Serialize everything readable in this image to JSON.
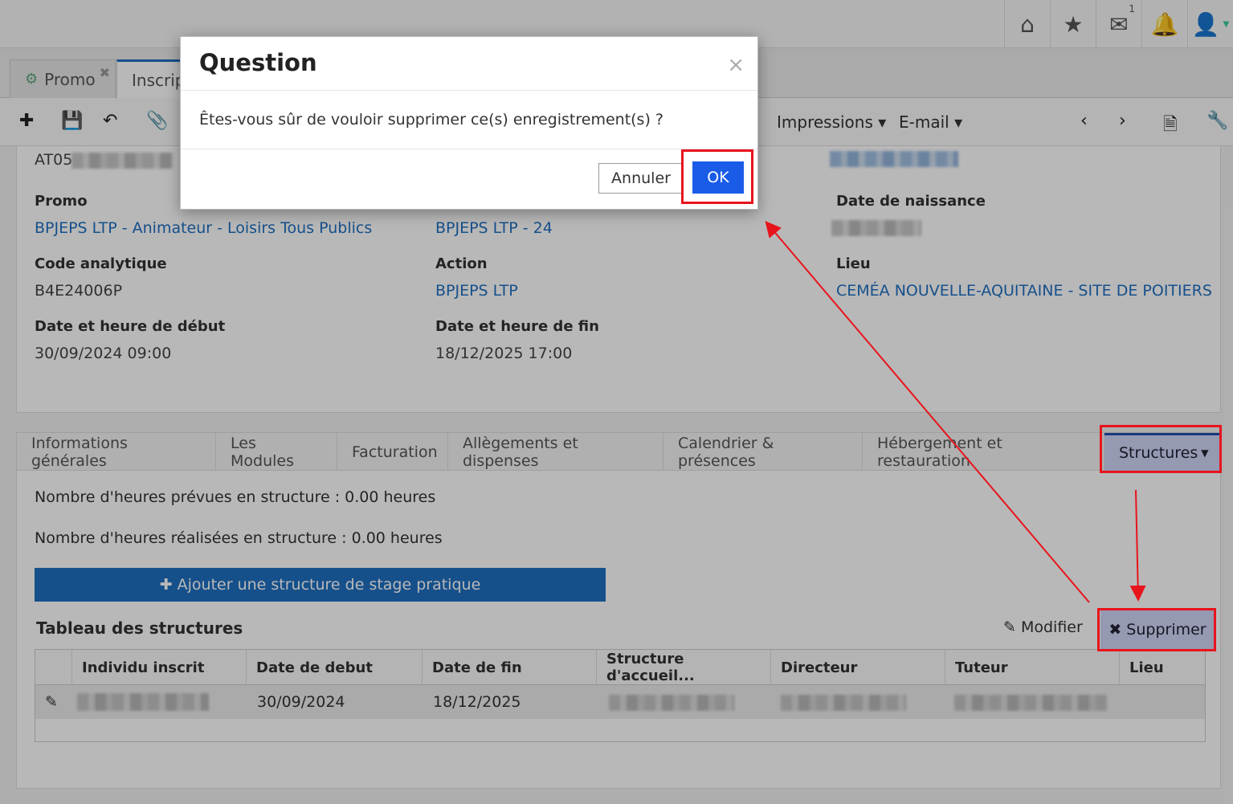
{
  "topbar": {
    "icons": [
      "home-icon",
      "star-icon",
      "envelope-icon",
      "bell-icon",
      "user-icon"
    ],
    "mail_count": "1"
  },
  "tabs": [
    {
      "label": "Promo"
    },
    {
      "label": "Inscrip"
    }
  ],
  "toolbar": {
    "impressions": "Impressions",
    "email": "E-mail"
  },
  "record": {
    "code_prefix": "AT05",
    "promo_label": "Promo",
    "promo_value": "BPJEPS LTP - Animateur - Loisirs Tous Publics",
    "promo2_value": "BPJEPS LTP - 24",
    "birth_label": "Date de naissance",
    "code_label": "Code analytique",
    "code_value": "B4E24006P",
    "action_label": "Action",
    "action_value": "BPJEPS LTP",
    "lieu_label": "Lieu",
    "lieu_value": "CEMÉA NOUVELLE-AQUITAINE - SITE DE POITIERS",
    "start_label": "Date et heure de début",
    "start_value": "30/09/2024 09:00",
    "end_label": "Date et heure de fin",
    "end_value": "18/12/2025 17:00"
  },
  "section_tabs": [
    "Informations générales",
    "Les Modules",
    "Facturation",
    "Allègements et dispenses",
    "Calendrier & présences",
    "Hébergement et restauration",
    "Structures"
  ],
  "structures": {
    "planned": "Nombre d'heures prévues en structure : 0.00 heures",
    "done": "Nombre d'heures réalisées en structure : 0.00 heures",
    "add_button": "Ajouter une structure de stage pratique",
    "table_title": "Tableau des structures",
    "modify": "Modifier",
    "delete": "Supprimer",
    "columns": [
      "Individu inscrit",
      "Date de debut",
      "Date de fin",
      "Structure d'accueil...",
      "Directeur",
      "Tuteur",
      "Lieu"
    ],
    "row": {
      "start": "30/09/2024",
      "end": "18/12/2025"
    }
  },
  "modal": {
    "title": "Question",
    "close": "×",
    "message": "Êtes-vous sûr de vouloir supprimer ce(s) enregistrement(s) ?",
    "cancel": "Annuler",
    "ok": "OK"
  },
  "colors": {
    "link": "#1f6fc1",
    "primary_button": "#1a5ce8",
    "highlight": "#e8141c"
  }
}
